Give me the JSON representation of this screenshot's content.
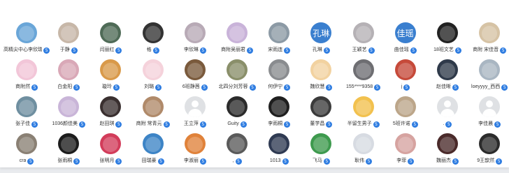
{
  "rows": [
    [
      {
        "name": "高精尖中心李欣瑞",
        "badge": "5",
        "color": "#6aa6d8",
        "icon": "balloon-photo-avatar"
      },
      {
        "name": "于静",
        "badge": "5",
        "color": "#c7b7a8",
        "icon": "person-photo-avatar"
      },
      {
        "name": "闫丽红",
        "badge": "5",
        "color": "#4f6b57",
        "icon": "person-photo-avatar"
      },
      {
        "name": "格",
        "badge": "5",
        "color": "#333333",
        "icon": "cat-photo-avatar"
      },
      {
        "name": "李欣琳",
        "badge": "5",
        "color": "#b8aab6",
        "icon": "person-photo-avatar"
      },
      {
        "name": "商附吴丽君",
        "badge": "5",
        "color": "#c9b3d9",
        "icon": "cartoon-avatar"
      },
      {
        "name": "宋雨连",
        "badge": "5",
        "color": "#8c9aa5",
        "icon": "person-photo-avatar"
      },
      {
        "name": "孔琳",
        "badge": "5",
        "color": "#3a7fcf",
        "text": "孔琳",
        "icon": "text-avatar"
      },
      {
        "name": "王颖艺",
        "badge": "5",
        "color": "#b5b1b5",
        "icon": "person-photo-avatar"
      },
      {
        "name": "曲佳瑶",
        "badge": "5",
        "color": "#3a7fcf",
        "text": "佳瑶",
        "icon": "text-avatar"
      },
      {
        "name": "18班文艺",
        "badge": "5",
        "color": "#222222",
        "icon": "person-photo-avatar"
      },
      {
        "name": "商附 宋佳音",
        "badge": "5",
        "color": "#d6c3a5",
        "icon": "person-photo-avatar"
      }
    ],
    [
      {
        "name": "商附然",
        "badge": "5",
        "color": "#f2c6d8",
        "icon": "cartoon-avatar"
      },
      {
        "name": "白金阳",
        "badge": "5",
        "color": "#d9a8b7",
        "icon": "person-photo-avatar"
      },
      {
        "name": "璇玲",
        "badge": "5",
        "color": "#d99a4a",
        "icon": "scenery-photo-avatar"
      },
      {
        "name": "刘璐",
        "badge": "5",
        "color": "#f5d2db",
        "icon": "drawing-avatar"
      },
      {
        "name": "6班静茜",
        "badge": "5",
        "color": "#7a5a3c",
        "icon": "person-photo-avatar"
      },
      {
        "name": "北四分刘芳蓉",
        "badge": "5",
        "color": "#8a8f6a",
        "icon": "person-photo-avatar"
      },
      {
        "name": "何伊宁",
        "badge": "5",
        "color": "#8a8c8f",
        "icon": "person-photo-avatar"
      },
      {
        "name": "魏欣慧",
        "badge": "5",
        "color": "#f2d2a0",
        "icon": "cartoon-avatar"
      },
      {
        "name": "155****9358",
        "badge": "5",
        "color": "#6e6e72",
        "icon": "person-photo-avatar"
      },
      {
        "name": "j",
        "badge": "5",
        "color": "#c64a3a",
        "icon": "person-photo-avatar"
      },
      {
        "name": "赵佳晰",
        "badge": "5",
        "color": "#2f3a4a",
        "icon": "person-photo-avatar"
      },
      {
        "name": "loeyyyy_西西",
        "badge": "5",
        "color": "#a9b6c2",
        "icon": "person-photo-avatar"
      }
    ],
    [
      {
        "name": "张子佳",
        "badge": "5",
        "color": "#6f8fa0",
        "icon": "person-photo-avatar"
      },
      {
        "name": "1036颜佳美",
        "badge": "5",
        "color": "#c9b5d8",
        "icon": "cartoon-avatar"
      },
      {
        "name": "赵田琪",
        "badge": "5",
        "color": "#3a3030",
        "icon": "person-photo-avatar"
      },
      {
        "name": "商附 常青元",
        "badge": "5",
        "color": "#b08a6a",
        "icon": "person-photo-avatar"
      },
      {
        "name": "王立萍",
        "badge": "5",
        "default": true,
        "icon": "default-user-avatar"
      },
      {
        "name": "Guity",
        "badge": "5",
        "color": "#2b2b2b",
        "icon": "person-photo-avatar"
      },
      {
        "name": "李雨桐",
        "badge": "5",
        "color": "#1f1f1f",
        "icon": "person-photo-avatar"
      },
      {
        "name": "董学昌",
        "badge": "5",
        "color": "#3b3b3b",
        "icon": "person-photo-avatar"
      },
      {
        "name": "半留生男子",
        "badge": "5",
        "color": "#f2c14e",
        "icon": "emoji-avatar"
      },
      {
        "name": "5班许诺",
        "badge": "5",
        "color": "#bca68a",
        "icon": "cat-photo-avatar"
      },
      {
        "name": ".",
        "badge": "5",
        "default": true,
        "icon": "default-user-avatar"
      },
      {
        "name": "李佳晨",
        "badge": "5",
        "default": true,
        "icon": "default-user-avatar"
      }
    ],
    [
      {
        "name": "cra",
        "badge": "5",
        "color": "#8a8074",
        "icon": "person-photo-avatar"
      },
      {
        "name": "张雨桐",
        "badge": "5",
        "color": "#1c1c1c",
        "icon": "person-photo-avatar"
      },
      {
        "name": "张明月",
        "badge": "5",
        "color": "#d23c5a",
        "icon": "cartoon-avatar"
      },
      {
        "name": "田瑞豪",
        "badge": "5",
        "color": "#3d84c6",
        "icon": "cartoon-avatar"
      },
      {
        "name": "李淑丽",
        "badge": "5",
        "color": "#e0823a",
        "icon": "flower-photo-avatar"
      },
      {
        "name": ",",
        "badge": "5",
        "color": "#5a5a5a",
        "icon": "person-photo-avatar"
      },
      {
        "name": "1013",
        "badge": "5",
        "color": "#2f3a52",
        "icon": "scenery-photo-avatar"
      },
      {
        "name": "飞马",
        "badge": "5",
        "color": "#3e9a4e",
        "icon": "cartoon-avatar"
      },
      {
        "name": "耿伟",
        "badge": "5",
        "color": "#d7dbe2",
        "icon": "cartoon-avatar"
      },
      {
        "name": "李菲",
        "badge": "5",
        "color": "#d6a3a0",
        "icon": "person-photo-avatar"
      },
      {
        "name": "魏丽杰",
        "badge": "5",
        "color": "#4a2a2a",
        "icon": "person-photo-avatar"
      },
      {
        "name": "9王歆然",
        "badge": "5",
        "color": "#2b2b2b",
        "icon": "person-photo-avatar"
      }
    ]
  ]
}
